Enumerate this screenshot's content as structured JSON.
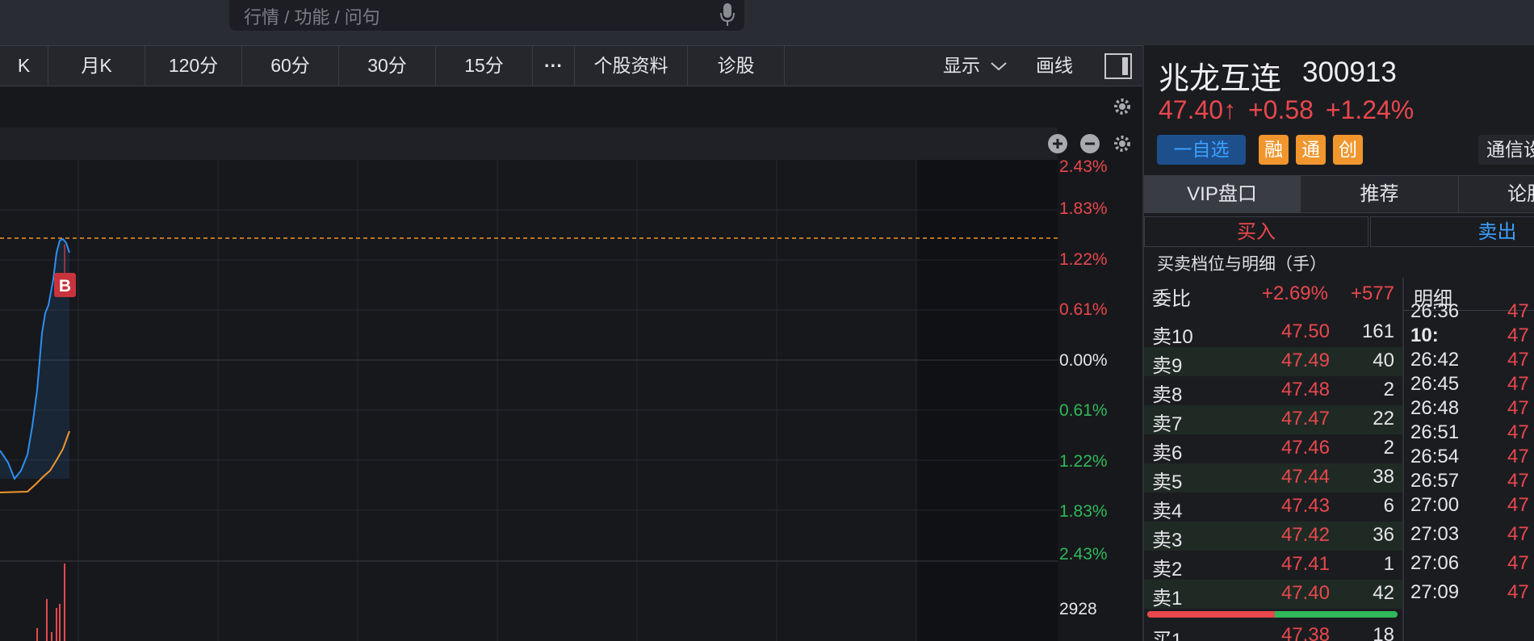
{
  "search": {
    "placeholder": "行情 / 功能 / 问句"
  },
  "toolbar": {
    "items": [
      "K",
      "月K",
      "120分",
      "60分",
      "30分",
      "15分",
      "···",
      "个股资料",
      "诊股"
    ],
    "display_label": "显示",
    "draw_label": "画线"
  },
  "chart": {
    "y_labels_up": [
      "2.43%",
      "1.83%",
      "1.22%",
      "0.61%"
    ],
    "y_label_zero": "0.00%",
    "y_labels_down": [
      "0.61%",
      "1.22%",
      "1.83%",
      "2.43%"
    ],
    "volume_label": "2928",
    "marker_label": "B",
    "colors": {
      "up": "#e8484d",
      "down": "#2fb95a",
      "price_line": "#2d8ff0",
      "avg_line": "#f0962d",
      "ref_line": "#f0962d"
    }
  },
  "stock": {
    "name": "兆龙互连",
    "code": "300913",
    "price": "47.40↑",
    "change": "+0.58",
    "change_pct": "+1.24%",
    "watch_label": "一自选",
    "badges": [
      "融",
      "通",
      "创"
    ],
    "industry_label": "通信设"
  },
  "tabs": [
    "VIP盘口",
    "推荐",
    "论股"
  ],
  "buy_label": "买入",
  "sell_label": "卖出",
  "section_title": "买卖档位与明细（手）",
  "ratio": {
    "label": "委比",
    "pct": "+2.69%",
    "diff": "+577"
  },
  "detail_title": "明细",
  "asks": [
    {
      "label": "卖10",
      "price": "47.50",
      "vol": "161"
    },
    {
      "label": "卖9",
      "price": "47.49",
      "vol": "40"
    },
    {
      "label": "卖8",
      "price": "47.48",
      "vol": "2"
    },
    {
      "label": "卖7",
      "price": "47.47",
      "vol": "22"
    },
    {
      "label": "卖6",
      "price": "47.46",
      "vol": "2"
    },
    {
      "label": "卖5",
      "price": "47.44",
      "vol": "38"
    },
    {
      "label": "卖4",
      "price": "47.43",
      "vol": "6"
    },
    {
      "label": "卖3",
      "price": "47.42",
      "vol": "36"
    },
    {
      "label": "卖2",
      "price": "47.41",
      "vol": "1"
    },
    {
      "label": "卖1",
      "price": "47.40",
      "vol": "42"
    }
  ],
  "bid_first": {
    "label": "买1",
    "price": "47.38",
    "vol": "18"
  },
  "ratio_bar": {
    "sell_fraction": 0.51
  },
  "details": [
    {
      "time": "26:36",
      "price": "47"
    },
    {
      "time": "10:",
      "price": "47"
    },
    {
      "time": "26:42",
      "price": "47"
    },
    {
      "time": "26:45",
      "price": "47"
    },
    {
      "time": "26:48",
      "price": "47"
    },
    {
      "time": "26:51",
      "price": "47"
    },
    {
      "time": "26:54",
      "price": "47"
    },
    {
      "time": "26:57",
      "price": "47"
    },
    {
      "time": "27:00",
      "price": "47"
    },
    {
      "time": "27:03",
      "price": "47"
    },
    {
      "time": "27:06",
      "price": "47"
    },
    {
      "time": "27:09",
      "price": "47"
    }
  ]
}
